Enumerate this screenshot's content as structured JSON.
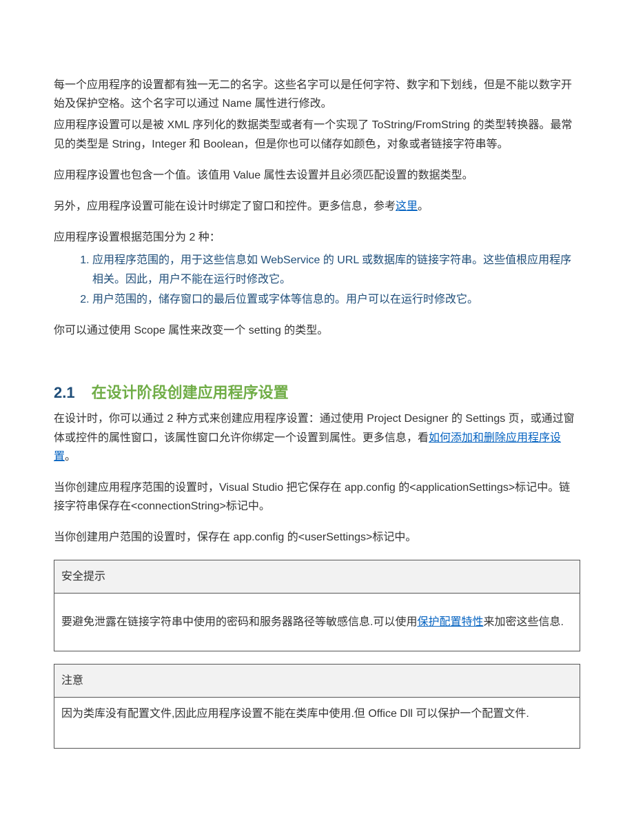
{
  "p1": "每一个应用程序的设置都有独一无二的名字。这些名字可以是任何字符、数字和下划线，但是不能以数字开始及保护空格。这个名字可以通过 Name 属性进行修改。",
  "p2": "应用程序设置可以是被 XML 序列化的数据类型或者有一个实现了 ToString/FromString 的类型转换器。最常见的类型是 String，Integer 和 Boolean，但是你也可以储存如颜色，对象或者链接字符串等。",
  "p3": "应用程序设置也包含一个值。该值用 Value 属性去设置并且必须匹配设置的数据类型。",
  "p4a": "另外，应用程序设置可能在设计时绑定了窗口和控件。更多信息，参考",
  "p4link": "这里",
  "p4b": "。",
  "p5": "应用程序设置根据范围分为 2 种：",
  "li1": "应用程序范围的，用于这些信息如 WebService 的 URL 或数据库的链接字符串。这些值根应用程序相关。因此，用户不能在运行时修改它。",
  "li2": "用户范围的，储存窗口的最后位置或字体等信息的。用户可以在运行时修改它。",
  "p6": "你可以通过使用 Scope 属性来改变一个 setting 的类型。",
  "h2num": "2.1",
  "h2text": "在设计阶段创建应用程序设置",
  "p7a": "在设计时，你可以通过 2 种方式来创建应用程序设置：通过使用 Project Designer 的 Settings 页，或通过窗体或控件的属性窗口，该属性窗口允许你绑定一个设置到属性。更多信息，看",
  "p7link": "如何添加和删除应用程序设置",
  "p7b": "。",
  "p8": "当你创建应用程序范围的设置时，Visual Studio 把它保存在 app.config 的<applicationSettings>标记中。链接字符串保存在<connectionString>标记中。",
  "p9": "当你创建用户范围的设置时，保存在 app.config 的<userSettings>标记中。",
  "box1header": "安全提示",
  "box1a": "要避免泄露在链接字符串中使用的密码和服务器路径等敏感信息.可以使用",
  "box1link": "保护配置特性",
  "box1b": "来加密这些信息.",
  "box2header": "注意",
  "box2body": "因为类库没有配置文件,因此应用程序设置不能在类库中使用.但 Office Dll 可以保护一个配置文件."
}
